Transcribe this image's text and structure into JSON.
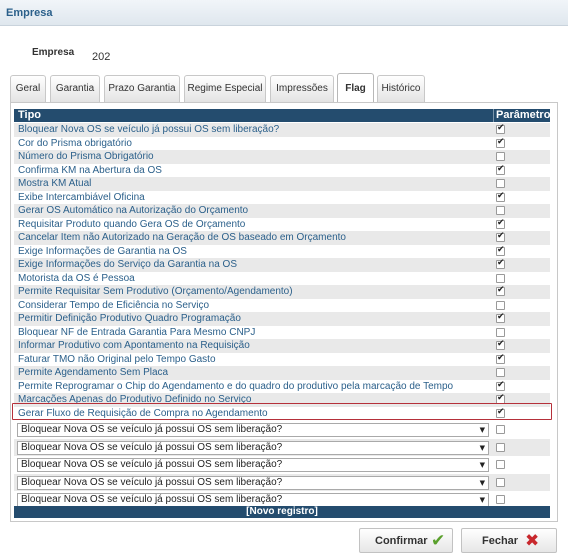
{
  "window": {
    "title": "Empresa"
  },
  "company": {
    "label": "Empresa",
    "value": "202"
  },
  "tabs": [
    {
      "label": "Geral",
      "active": false
    },
    {
      "label": "Garantia",
      "active": false
    },
    {
      "label": "Prazo Garantia",
      "active": false
    },
    {
      "label": "Regime Especial",
      "active": false
    },
    {
      "label": "Impressões",
      "active": false
    },
    {
      "label": "Flag",
      "active": true
    },
    {
      "label": "Histórico",
      "active": false
    }
  ],
  "table": {
    "headers": {
      "tipo": "Tipo",
      "parametro": "Parâmetro"
    },
    "rows": [
      {
        "label": "Bloquear Nova OS se veículo já possui OS sem liberação?",
        "checked": true
      },
      {
        "label": "Cor do Prisma obrigatório",
        "checked": true
      },
      {
        "label": "Número do Prisma Obrigatório",
        "checked": false
      },
      {
        "label": "Confirma KM na Abertura da OS",
        "checked": true
      },
      {
        "label": "Mostra KM Atual",
        "checked": false
      },
      {
        "label": "Exibe Intercambiável Oficina",
        "checked": true
      },
      {
        "label": "Gerar OS Automático na Autorização do Orçamento",
        "checked": false
      },
      {
        "label": "Requisitar Produto quando Gera OS de Orçamento",
        "checked": true
      },
      {
        "label": "Cancelar Item não Autorizado na Geração de OS baseado em Orçamento",
        "checked": true
      },
      {
        "label": "Exige Informações de Garantia na OS",
        "checked": true
      },
      {
        "label": "Exige Informações do Serviço da Garantia na OS",
        "checked": true
      },
      {
        "label": "Motorista da OS é Pessoa",
        "checked": false
      },
      {
        "label": "Permite Requisitar Sem Produtivo (Orçamento/Agendamento)",
        "checked": true
      },
      {
        "label": "Considerar Tempo de Eficiência no Serviço",
        "checked": false
      },
      {
        "label": "Permitir Definição Produtivo Quadro Programação",
        "checked": true
      },
      {
        "label": "Bloquear NF de Entrada Garantia Para Mesmo CNPJ",
        "checked": false
      },
      {
        "label": "Informar Produtivo com Apontamento na Requisição",
        "checked": true
      },
      {
        "label": "Faturar TMO não Original pelo Tempo Gasto",
        "checked": true
      },
      {
        "label": "Permite Agendamento Sem Placa",
        "checked": false
      },
      {
        "label": "Permite Reprogramar o Chip do Agendamento e do quadro do produtivo pela marcação de Tempo",
        "checked": true
      },
      {
        "label": "Marcações Apenas do Produtivo Definido no Serviço",
        "checked": true
      },
      {
        "label": "Gerar Fluxo de Requisição de Compra no Agendamento",
        "checked": true
      }
    ],
    "new_rows": [
      {
        "selected": "Bloquear Nova OS se veículo já possui OS sem liberação?",
        "checked": false
      },
      {
        "selected": "Bloquear Nova OS se veículo já possui OS sem liberação?",
        "checked": false
      },
      {
        "selected": "Bloquear Nova OS se veículo já possui OS sem liberação?",
        "checked": false
      },
      {
        "selected": "Bloquear Nova OS se veículo já possui OS sem liberação?",
        "checked": false
      },
      {
        "selected": "Bloquear Nova OS se veículo já possui OS sem liberação?",
        "checked": false
      }
    ],
    "new_record_label": "[Novo registro]",
    "dropdown_arrow": "▼"
  },
  "buttons": {
    "confirm": {
      "label": "Confirmar",
      "icon": "check-icon",
      "icon_glyph": "✔",
      "color": "#5aa02c"
    },
    "close": {
      "label": "Fechar",
      "icon": "close-icon",
      "icon_glyph": "✖",
      "color": "#c8282d"
    }
  },
  "colors": {
    "header": "#244c6e",
    "row_text": "#2a5f8a",
    "highlight": "#b5303a"
  }
}
